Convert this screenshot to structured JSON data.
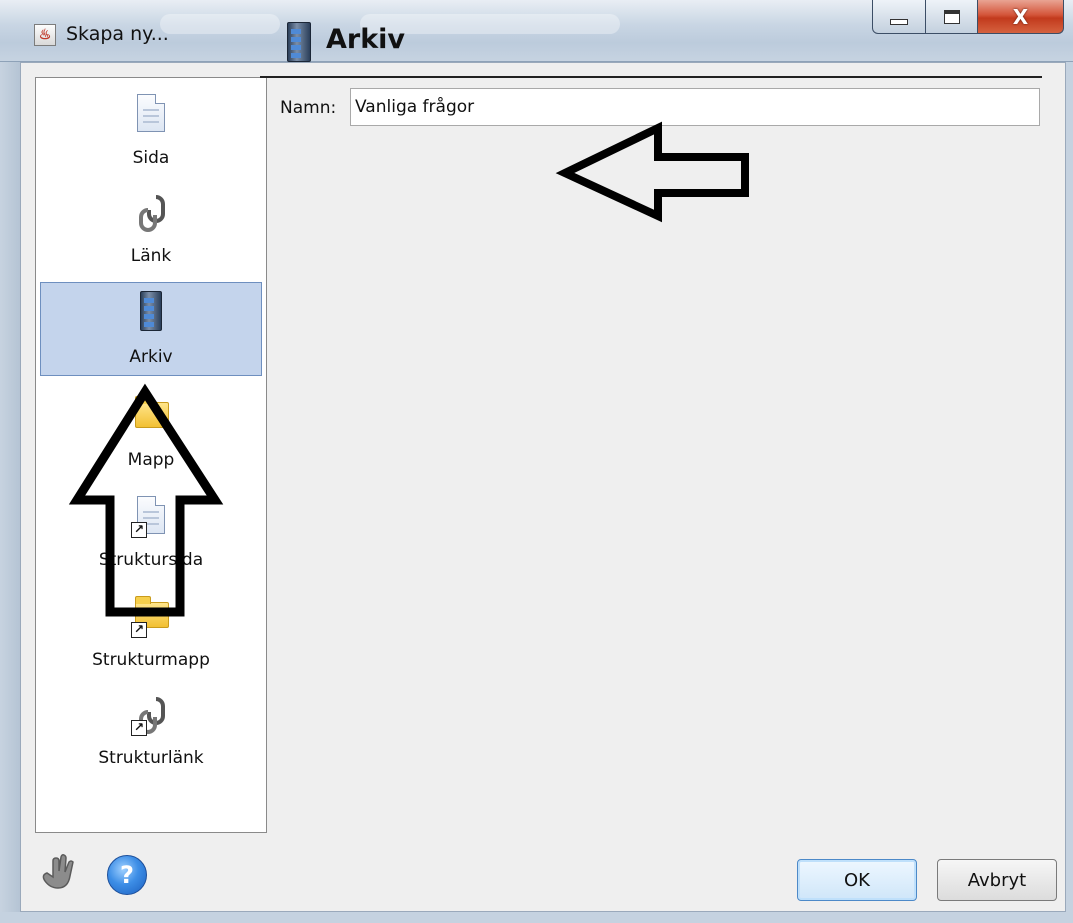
{
  "window": {
    "title": "Skapa ny...",
    "app_icon": "java-cup-icon",
    "controls": [
      "minimize",
      "maximize",
      "close"
    ],
    "close_glyph": "X"
  },
  "type_list": {
    "items": [
      {
        "label": "Sida",
        "icon": "page-icon"
      },
      {
        "label": "Länk",
        "icon": "link-icon"
      },
      {
        "label": "Arkiv",
        "icon": "archive-server-icon",
        "selected": true
      },
      {
        "label": "Mapp",
        "icon": "folder-icon"
      },
      {
        "label": "Struktursida",
        "icon": "shortcut-page-icon"
      },
      {
        "label": "Strukturmapp",
        "icon": "shortcut-folder-icon"
      },
      {
        "label": "Strukturlänk",
        "icon": "shortcut-link-icon"
      }
    ]
  },
  "header": {
    "title": "Arkiv",
    "icon": "archive-server-icon"
  },
  "form": {
    "name_label": "Namn:",
    "name_value": "Vanliga frågor"
  },
  "footer": {
    "help_icon": "hand-icon",
    "question_glyph": "?",
    "ok_label": "OK",
    "cancel_label": "Avbryt"
  },
  "colors": {
    "selection": "#c4d4ec",
    "titlebar": "#c9d6e4",
    "close_button": "#c23a1d"
  }
}
